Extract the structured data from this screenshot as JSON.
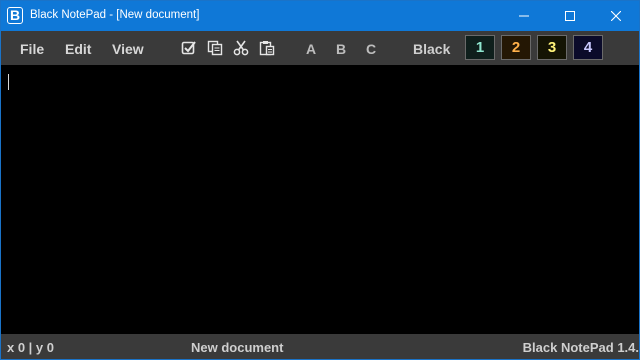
{
  "window": {
    "title": "Black NotePad - [New document]",
    "app_icon_letter": "B",
    "accent_color": "#0f78d7"
  },
  "window_controls": {
    "minimize_icon": "minimize-icon",
    "maximize_icon": "maximize-icon",
    "close_icon": "close-icon"
  },
  "menu": {
    "items": [
      "File",
      "Edit",
      "View"
    ]
  },
  "toolbar": {
    "icons": [
      "select-all-icon",
      "copy-icon",
      "cut-icon",
      "paste-icon"
    ],
    "font_buttons": [
      "A",
      "B",
      "C"
    ],
    "theme_label": "Black",
    "theme_buttons": [
      {
        "label": "1",
        "color": "#8fe6cf"
      },
      {
        "label": "2",
        "color": "#ffb04a"
      },
      {
        "label": "3",
        "color": "#fff37a"
      },
      {
        "label": "4",
        "color": "#c8c8ff"
      }
    ]
  },
  "editor": {
    "content": ""
  },
  "status": {
    "coords": "x 0 | y 0",
    "document": "New document",
    "app_version": "Black NotePad 1.4."
  }
}
